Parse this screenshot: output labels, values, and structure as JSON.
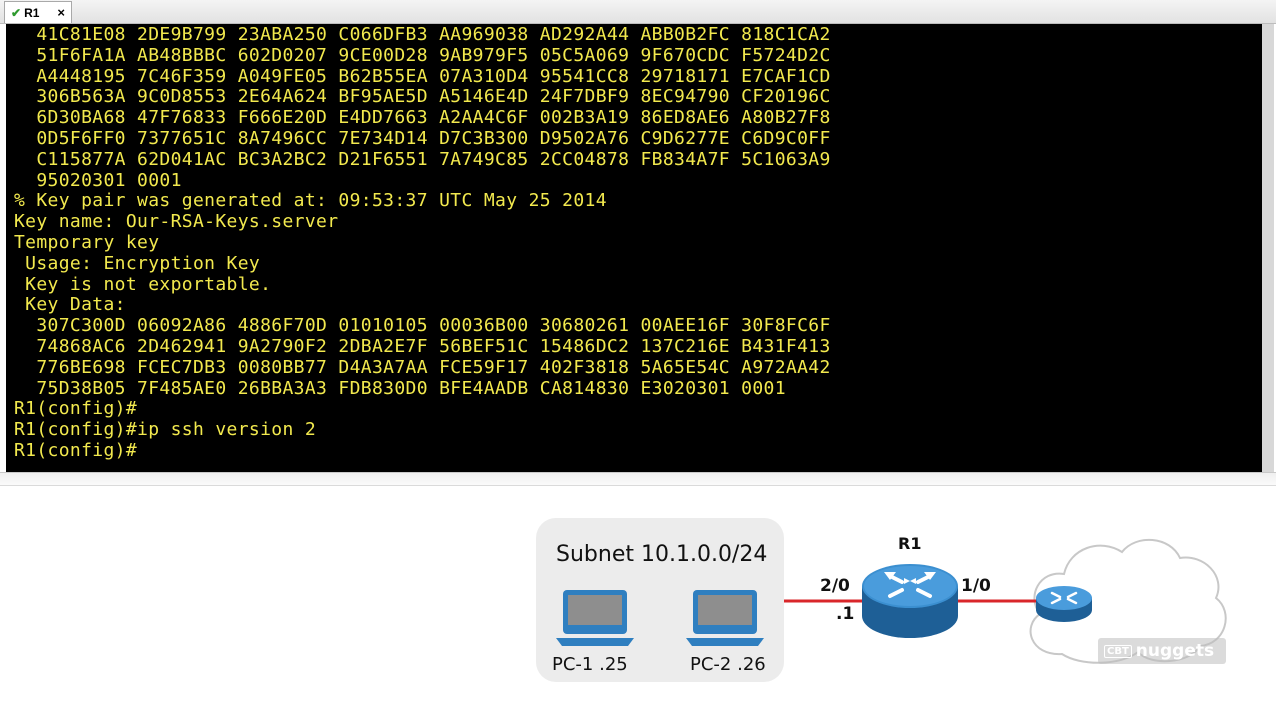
{
  "window": {
    "tab_label": "R1",
    "tab_close": "×"
  },
  "terminal": {
    "lines": [
      "  41C81E08 2DE9B799 23ABA250 C066DFB3 AA969038 AD292A44 ABB0B2FC 818C1CA2",
      "  51F6FA1A AB48BBBC 602D0207 9CE00D28 9AB979F5 05C5A069 9F670CDC F5724D2C",
      "  A4448195 7C46F359 A049FE05 B62B55EA 07A310D4 95541CC8 29718171 E7CAF1CD",
      "  306B563A 9C0D8553 2E64A624 BF95AE5D A5146E4D 24F7DBF9 8EC94790 CF20196C",
      "  6D30BA68 47F76833 F666E20D E4DD7663 A2AA4C6F 002B3A19 86ED8AE6 A80B27F8",
      "  0D5F6FF0 7377651C 8A7496CC 7E734D14 D7C3B300 D9502A76 C9D6277E C6D9C0FF",
      "  C115877A 62D041AC BC3A2BC2 D21F6551 7A749C85 2CC04878 FB834A7F 5C1063A9",
      "  95020301 0001",
      "% Key pair was generated at: 09:53:37 UTC May 25 2014",
      "Key name: Our-RSA-Keys.server",
      "Temporary key",
      " Usage: Encryption Key",
      " Key is not exportable.",
      " Key Data:",
      "  307C300D 06092A86 4886F70D 01010105 00036B00 30680261 00AEE16F 30F8FC6F",
      "  74868AC6 2D462941 9A2790F2 2DBA2E7F 56BEF51C 15486DC2 137C216E B431F413",
      "  776BE698 FCEC7DB3 0080BB77 D4A3A7AA FCE59F17 402F3818 5A65E54C A972AA42",
      "  75D38B05 7F485AE0 26BBA3A3 FDB830D0 BFE4AADB CA814830 E3020301 0001",
      "R1(config)#",
      "R1(config)#ip ssh version 2",
      "R1(config)#"
    ],
    "text_color": "#f2e94e",
    "background": "#000000"
  },
  "diagram": {
    "subnet_title": "Subnet 10.1.0.0/24",
    "pc1_label": "PC-1  .25",
    "pc2_label": "PC-2  .26",
    "router_name": "R1",
    "iface_left": "2/0",
    "iface_left_ip": ".1",
    "iface_right": "1/0",
    "link_color": "#d9262a",
    "router_color": "#2f7fc0",
    "watermark_a": "CBT",
    "watermark_b": "nuggets"
  }
}
